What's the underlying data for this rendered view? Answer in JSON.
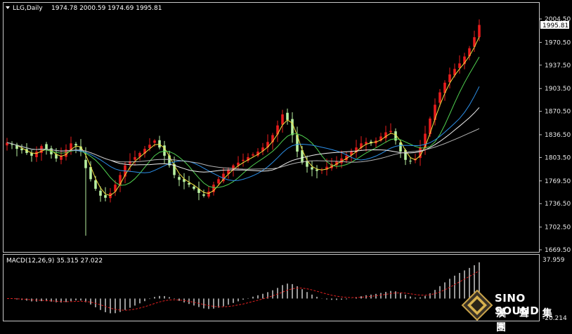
{
  "header": {
    "symbol": "LLG,Daily",
    "ohlc": "1974.78 2000.59 1974.69 1995.81"
  },
  "macd_header": "MACD(12,26,9) 35.315 27.022",
  "brand": {
    "name": "SINO SOUND",
    "chinese": "漢 聲 集 團"
  },
  "colors": {
    "background": "#000000",
    "axis": "#c8c8c8",
    "up_candle": "#e81c1c",
    "down_candle": "#b8f0a0",
    "ma_fast": "#f0e040",
    "ma_green": "#50d050",
    "ma_blue": "#2c8fe8",
    "ma_white": "#f0f0f0",
    "ma_gray": "#b4b4b4",
    "macd_hist": "#ffffff",
    "macd_signal": "#e02020"
  },
  "chart_data": [
    {
      "type": "candlestick",
      "title": "LLG,Daily",
      "last_price_label": "1995.81",
      "y_ticks": [
        "2004.50",
        "1970.50",
        "1937.50",
        "1903.50",
        "1870.50",
        "1836.50",
        "1803.50",
        "1769.50",
        "1736.50",
        "1702.50",
        "1669.50"
      ],
      "ylim": [
        1669.5,
        2004.5
      ],
      "series_closes": [
        1825,
        1822,
        1816,
        1814,
        1810,
        1806,
        1812,
        1820,
        1814,
        1808,
        1802,
        1806,
        1815,
        1824,
        1821,
        1812,
        1788,
        1772,
        1758,
        1748,
        1745,
        1752,
        1764,
        1778,
        1792,
        1798,
        1804,
        1810,
        1816,
        1822,
        1828,
        1818,
        1806,
        1792,
        1778,
        1771,
        1768,
        1764,
        1758,
        1752,
        1748,
        1754,
        1764,
        1772,
        1780,
        1786,
        1792,
        1796,
        1800,
        1804,
        1808,
        1812,
        1818,
        1826,
        1836,
        1850,
        1866,
        1858,
        1836,
        1812,
        1796,
        1790,
        1786,
        1784,
        1786,
        1790,
        1794,
        1798,
        1802,
        1806,
        1812,
        1818,
        1824,
        1826,
        1824,
        1828,
        1834,
        1840,
        1842,
        1828,
        1812,
        1800,
        1798,
        1802,
        1818,
        1838,
        1860,
        1880,
        1898,
        1912,
        1924,
        1932,
        1940,
        1950,
        1962,
        1978,
        1995.81
      ],
      "ma_note": "five moving averages: yellow, green, blue, white, gray"
    },
    {
      "type": "bar",
      "title": "MACD(12,26,9) 35.315 27.022",
      "macd_value": 35.315,
      "signal_value": 27.022,
      "y_ticks": [
        "37.959",
        "-20.214"
      ],
      "ylim": [
        -20.214,
        37.959
      ]
    }
  ]
}
